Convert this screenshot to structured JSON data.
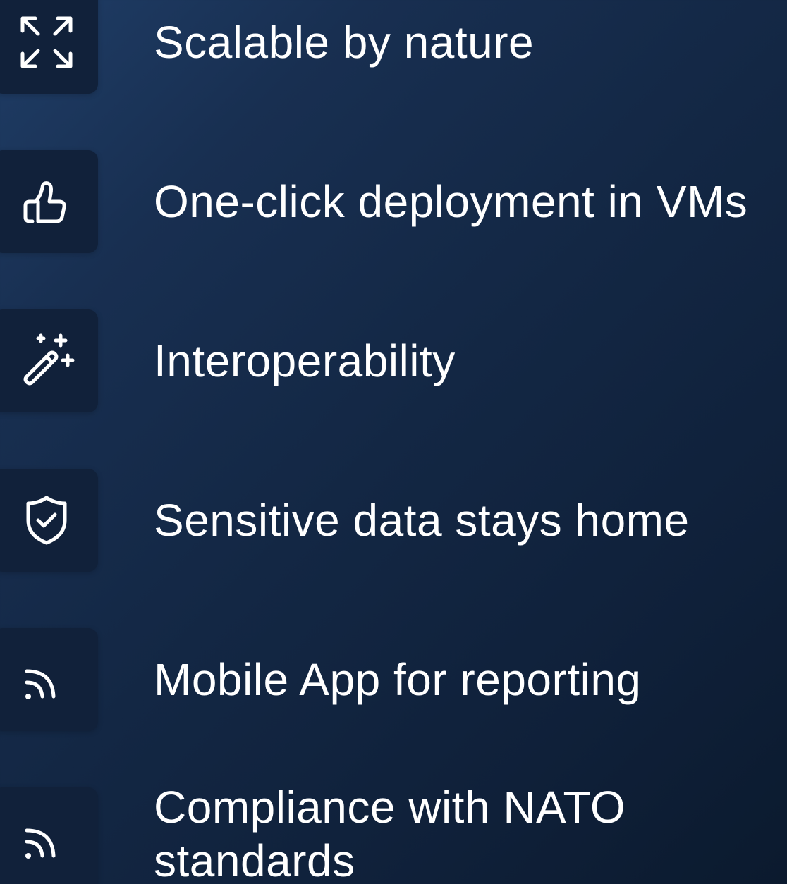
{
  "features": [
    {
      "label": "Scalable by nature",
      "icon": "arrows-expand-icon"
    },
    {
      "label": "One-click deployment in VMs",
      "icon": "thumbs-up-icon"
    },
    {
      "label": "Interoperability",
      "icon": "magic-wand-icon"
    },
    {
      "label": "Sensitive data stays home",
      "icon": "shield-check-icon"
    },
    {
      "label": "Mobile App for reporting",
      "icon": "rss-icon"
    },
    {
      "label": "Compliance with NATO standards",
      "icon": "rss-icon"
    }
  ],
  "colors": {
    "background_start": "#1f3d66",
    "background_end": "#0b1a2e",
    "icon_box": "#11213a",
    "text": "#ffffff"
  }
}
